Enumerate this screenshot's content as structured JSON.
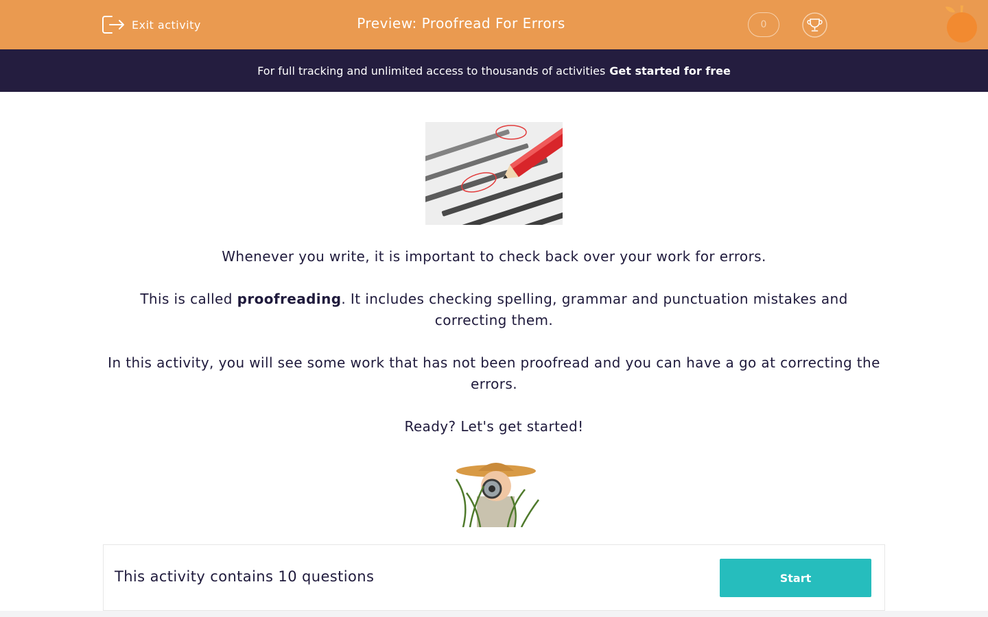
{
  "header": {
    "exit_label": "Exit activity",
    "title": "Preview: Proofread For Errors",
    "score": "0",
    "icons": [
      "exit-icon",
      "trophy-icon",
      "orange-logo-icon"
    ]
  },
  "banner": {
    "text": "For full tracking and unlimited access to thousands of activities",
    "link": "Get started for free"
  },
  "content": {
    "images": [
      "proofreading-red-pencil-image",
      "boy-with-magnifying-glass-image"
    ],
    "p1": "Whenever you write, it is important to check back over your work for errors.",
    "p2_before": "This is called ",
    "p2_bold": "proofreading",
    "p2_after": ". It includes checking spelling, grammar and punctuation mistakes and correcting them.",
    "p3": "In this activity, you will see some work that has not been proofread and you can have a go at correcting the errors.",
    "p4": "Ready? Let's get started!"
  },
  "footer": {
    "text": "This activity contains 10 questions",
    "start_label": "Start"
  },
  "colors": {
    "header": "#ea9a50",
    "banner": "#241d3f",
    "start_button": "#26bdbd",
    "text": "#1f1a3c"
  }
}
